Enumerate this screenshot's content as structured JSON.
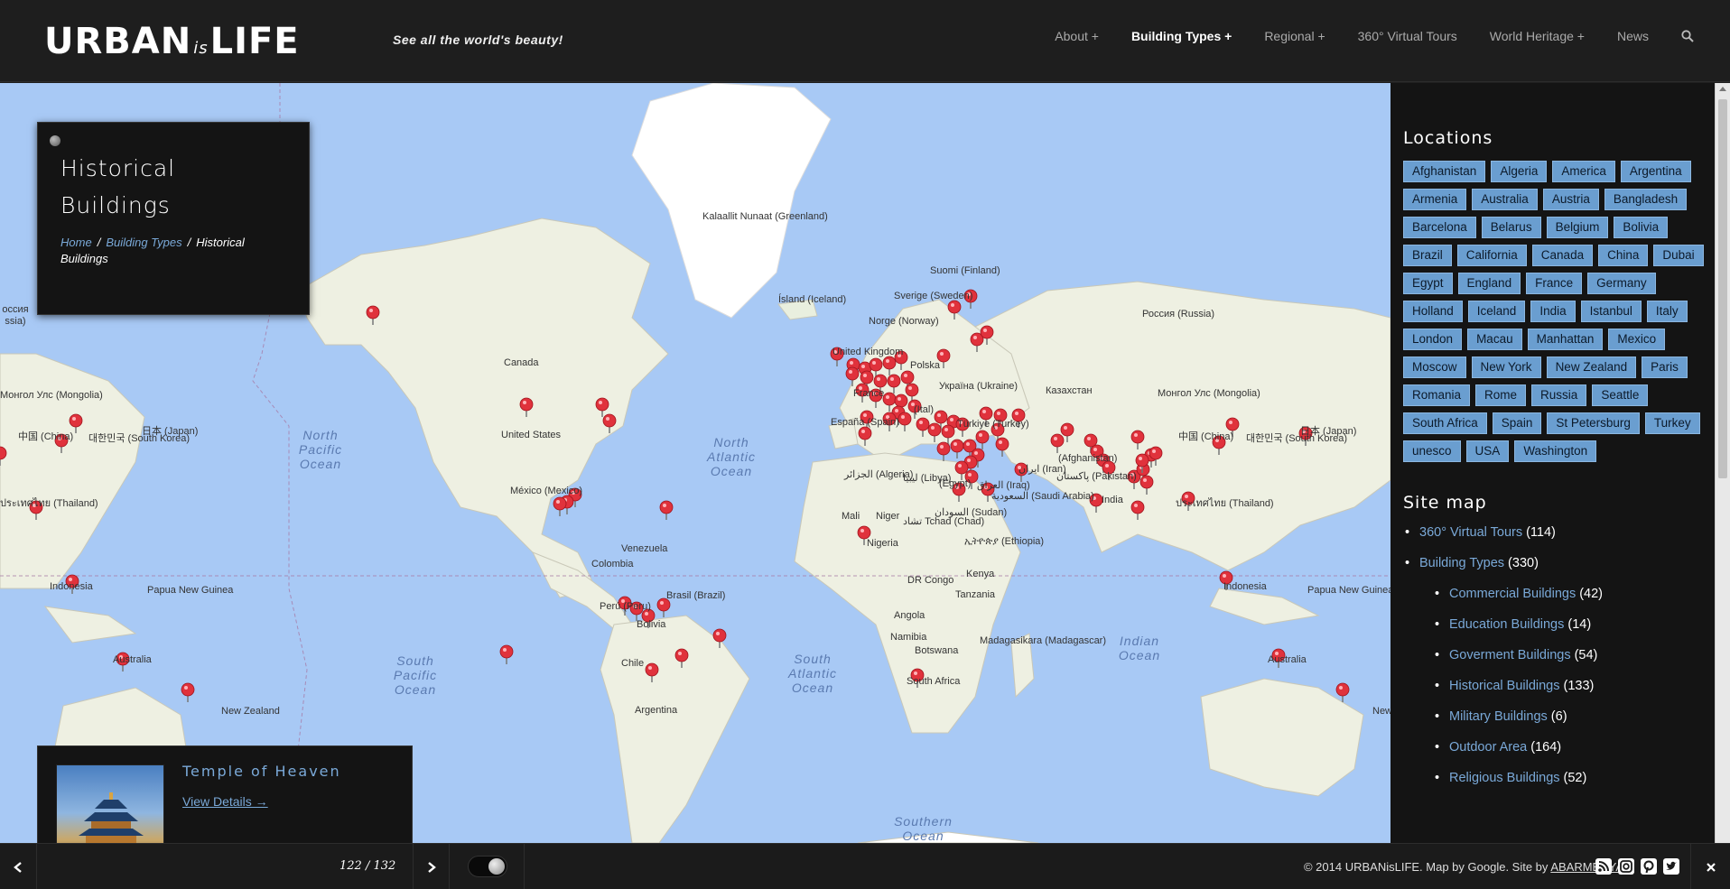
{
  "header": {
    "logo_main": "URBAN",
    "logo_is": "is",
    "logo_end": "LIFE",
    "tagline": "See all the world's beauty!",
    "nav": [
      {
        "label": "About  +",
        "active": false
      },
      {
        "label": "Building Types  +",
        "active": true
      },
      {
        "label": "Regional  +",
        "active": false
      },
      {
        "label": "360° Virtual Tours",
        "active": false
      },
      {
        "label": "World Heritage  +",
        "active": false
      },
      {
        "label": "News",
        "active": false
      }
    ]
  },
  "page": {
    "title": "Historical Buildings",
    "breadcrumb": {
      "home": "Home",
      "section": "Building Types",
      "current": "Historical Buildings"
    }
  },
  "map_labels": {
    "greenland": "Kalaallit Nunaat (Greenland)",
    "iceland": "Ísland (Iceland)",
    "canada": "Canada",
    "us": "United States",
    "mexico": "México (Mexico)",
    "venezuela": "Venezuela",
    "colombia": "Colombia",
    "peru": "Perú (Peru)",
    "brazil": "Brasil (Brazil)",
    "bolivia": "Bolivia",
    "chile": "Chile",
    "argentina": "Argentina",
    "russia": "Россия (Russia)",
    "finland": "Suomi (Finland)",
    "sweden": "Sverige (Sweden)",
    "norway": "Norge (Norway)",
    "kazakhstan": "Казахстан",
    "india": "India",
    "mongolia": "Монгол Улс (Mongolia)",
    "china": "中国 (China)",
    "korea": "대한민국 (South Korea)",
    "japan": "日本 (Japan)",
    "thailand": "ประเทศไทย (Thailand)",
    "indonesia": "Indonesia",
    "png": "Papua New Guinea",
    "australia": "Australia",
    "nz": "New Zealand",
    "algeria": "الجزائر (Algeria)",
    "libya": "ليبيا (Libya)",
    "egypt": "(Egypt)",
    "mali": "Mali",
    "niger": "Niger",
    "chad": "تشاد Tchad (Chad)",
    "sudan": "السودان (Sudan)",
    "ethiopia": "ኢትዮጵያ (Ethiopia)",
    "nigeria": "Nigeria",
    "drc": "DR Congo",
    "kenya": "Kenya",
    "tanzania": "Tanzania",
    "angola": "Angola",
    "namibia": "Namibia",
    "botswana": "Botswana",
    "madagascar": "Madagasikara (Madagascar)",
    "south_africa": "South Africa",
    "iraq": "العراق (Iraq)",
    "iran": "ايران (Iran)",
    "saudi": "السعودية (Saudi Arabia)",
    "pakistan": "پاکستان (Pakistan)",
    "afghanistan": "(Afghanistan)",
    "ukraine": "Україна (Ukraine)",
    "poland": "Polska",
    "turkey": "Türkiye (Turkey)",
    "spain": "España (Spain)",
    "france": "France",
    "italy": "(Ital)",
    "uk": "United Kingdom",
    "n_pacific": "North Pacific Ocean",
    "n_atlantic": "North Atlantic Ocean",
    "s_pacific": "South Pacific Ocean",
    "s_atlantic": "South Atlantic Ocean",
    "indian": "Indian Ocean",
    "southern": "Southern Ocean",
    "left_russia": "оссия ssia)",
    "left_mongolia": "Монгол Улс (Mongolia)",
    "left_china": "中国 (China)",
    "left_korea": "대한민국 (South Korea)",
    "left_japan": "日本 (Japan)",
    "left_thailand": "ประเทศไทย (Thailand)",
    "left_indonesia": "Indonesia",
    "left_png": "Papua New Guinea",
    "left_australia": "Australia",
    "left_nz": "New Zealand"
  },
  "sidebar": {
    "locations_title": "Locations",
    "tags": [
      "Afghanistan",
      "Algeria",
      "America",
      "Argentina",
      "Armenia",
      "Australia",
      "Austria",
      "Bangladesh",
      "Barcelona",
      "Belarus",
      "Belgium",
      "Bolivia",
      "Brazil",
      "California",
      "Canada",
      "China",
      "Dubai",
      "Egypt",
      "England",
      "France",
      "Germany",
      "Holland",
      "Iceland",
      "India",
      "Istanbul",
      "Italy",
      "London",
      "Macau",
      "Manhattan",
      "Mexico",
      "Moscow",
      "New York",
      "New Zealand",
      "Paris",
      "Romania",
      "Rome",
      "Russia",
      "Seattle",
      "South Africa",
      "Spain",
      "St Petersburg",
      "Turkey",
      "unesco",
      "USA",
      "Washington"
    ],
    "sitemap_title": "Site map",
    "sitemap": [
      {
        "label": "360° Virtual Tours",
        "count": "(114)"
      },
      {
        "label": "Building Types",
        "count": "(330)"
      }
    ],
    "sitemap_sub": [
      {
        "label": "Commercial Buildings",
        "count": "(42)"
      },
      {
        "label": "Education Buildings",
        "count": "(14)"
      },
      {
        "label": "Goverment Buildings",
        "count": "(54)"
      },
      {
        "label": "Historical Buildings",
        "count": "(133)"
      },
      {
        "label": "Military Buildings",
        "count": "(6)"
      },
      {
        "label": "Outdoor Area",
        "count": "(164)"
      },
      {
        "label": "Religious Buildings",
        "count": "(52)"
      }
    ]
  },
  "card": {
    "title": "Temple of Heaven",
    "link": "View Details →"
  },
  "footer": {
    "counter": "122 / 132",
    "copyright_prefix": "© 2014 URBANisLIFE. Map by Google. Site by",
    "author": "ABARMEDYA"
  },
  "colors": {
    "ocean": "#a8c9f5",
    "land": "#eef0e2",
    "pin": "#e0323c",
    "accent": "#7aa9d8",
    "tag_bg": "#6a9ed0"
  },
  "icons": [
    "search-icon",
    "rss-icon",
    "instagram-icon",
    "pinterest-icon",
    "twitter-icon",
    "close-icon",
    "arrow-left-icon",
    "arrow-right-icon"
  ]
}
